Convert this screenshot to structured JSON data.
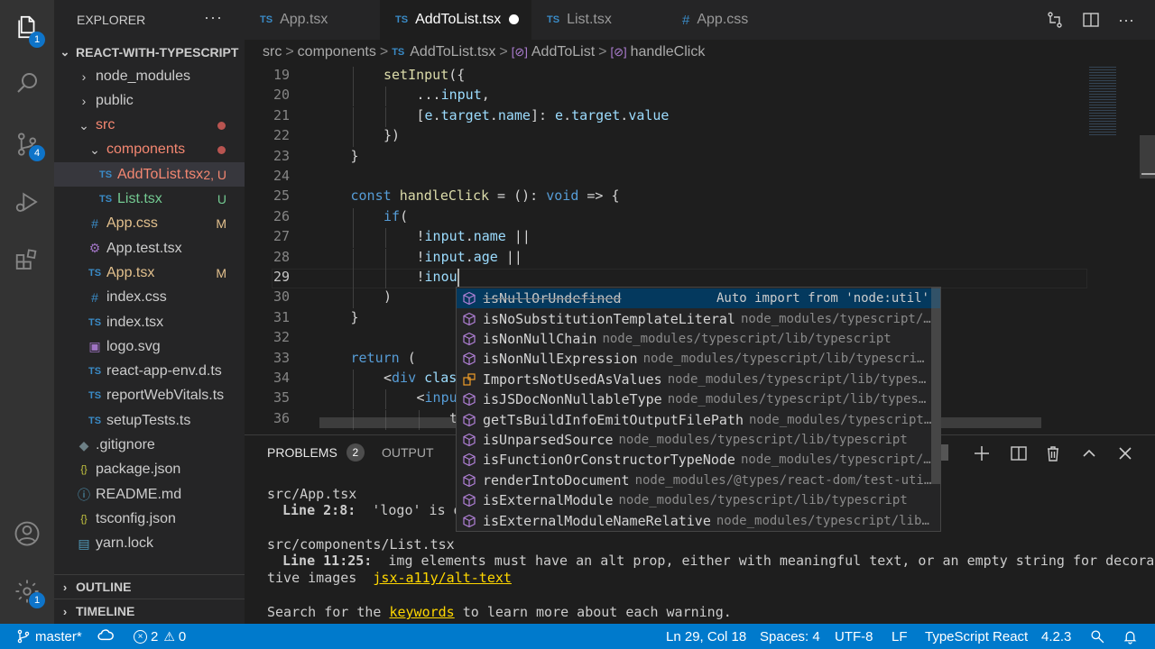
{
  "activity": {
    "explorer_badge": "1",
    "scm_badge": "4",
    "settings_badge": "1"
  },
  "sidebar": {
    "title": "EXPLORER",
    "dots": "···",
    "root": "REACT-WITH-TYPESCRIPT",
    "items": [
      {
        "label": "node_modules",
        "status": ""
      },
      {
        "label": "public",
        "status": ""
      },
      {
        "label": "src",
        "status": ""
      },
      {
        "label": "components",
        "status": ""
      },
      {
        "label": "AddToList.tsx",
        "status": "2, U"
      },
      {
        "label": "List.tsx",
        "status": "U"
      },
      {
        "label": "App.css",
        "status": "M"
      },
      {
        "label": "App.test.tsx",
        "status": ""
      },
      {
        "label": "App.tsx",
        "status": "M"
      },
      {
        "label": "index.css",
        "status": ""
      },
      {
        "label": "index.tsx",
        "status": ""
      },
      {
        "label": "logo.svg",
        "status": ""
      },
      {
        "label": "react-app-env.d.ts",
        "status": ""
      },
      {
        "label": "reportWebVitals.ts",
        "status": ""
      },
      {
        "label": "setupTests.ts",
        "status": ""
      },
      {
        "label": ".gitignore",
        "status": ""
      },
      {
        "label": "package.json",
        "status": ""
      },
      {
        "label": "README.md",
        "status": ""
      },
      {
        "label": "tsconfig.json",
        "status": ""
      },
      {
        "label": "yarn.lock",
        "status": ""
      }
    ],
    "outline": "OUTLINE",
    "timeline": "TIMELINE"
  },
  "tabs": [
    {
      "label": "App.tsx",
      "icon": "TS"
    },
    {
      "label": "AddToList.tsx",
      "icon": "TS"
    },
    {
      "label": "List.tsx",
      "icon": "TS"
    },
    {
      "label": "App.css",
      "icon": "#"
    }
  ],
  "breadcrumb": {
    "c1": "src",
    "c2": "components",
    "c3": "AddToList.tsx",
    "c4": "AddToList",
    "c5": "handleClick",
    "sep": ">",
    "ts": "TS",
    "sym": "[⊘]"
  },
  "editor": {
    "line_numbers": [
      "19",
      "20",
      "21",
      "22",
      "23",
      "24",
      "25",
      "26",
      "27",
      "28",
      "29",
      "30",
      "31",
      "32",
      "33",
      "34",
      "35",
      "36"
    ],
    "lines": [
      "setInput({",
      "...input,",
      "[e.target.name]: e.target.value",
      "})",
      "}",
      "",
      "const handleClick = (): void => {",
      "if(",
      "!input.name ||",
      "!input.age ||",
      "!inou",
      ")",
      "}",
      "",
      "return (",
      "<div clas",
      "<inpu",
      "t"
    ]
  },
  "suggest": [
    {
      "label": "isNullOrUndefined",
      "detail": "Auto import from 'node:util'",
      "icon": "cube-icon"
    },
    {
      "label": "isNoSubstitutionTemplateLiteral",
      "detail": "node_modules/typescript/…",
      "icon": "cube-icon"
    },
    {
      "label": "isNonNullChain",
      "detail": "node_modules/typescript/lib/typescript",
      "icon": "cube-icon"
    },
    {
      "label": "isNonNullExpression",
      "detail": "node_modules/typescript/lib/typescri…",
      "icon": "cube-icon"
    },
    {
      "label": "ImportsNotUsedAsValues",
      "detail": "node_modules/typescript/lib/types…",
      "icon": "enum-icon"
    },
    {
      "label": "isJSDocNonNullableType",
      "detail": "node_modules/typescript/lib/types…",
      "icon": "cube-icon"
    },
    {
      "label": "getTsBuildInfoEmitOutputFilePath",
      "detail": "node_modules/typescript…",
      "icon": "cube-icon"
    },
    {
      "label": "isUnparsedSource",
      "detail": "node_modules/typescript/lib/typescript",
      "icon": "cube-icon"
    },
    {
      "label": "isFunctionOrConstructorTypeNode",
      "detail": "node_modules/typescript/…",
      "icon": "cube-icon"
    },
    {
      "label": "renderIntoDocument",
      "detail": "node_modules/@types/react-dom/test-uti…",
      "icon": "cube-icon"
    },
    {
      "label": "isExternalModule",
      "detail": "node_modules/typescript/lib/typescript",
      "icon": "cube-icon"
    },
    {
      "label": "isExternalModuleNameRelative",
      "detail": "node_modules/typescript/lib…",
      "icon": "cube-icon"
    }
  ],
  "panel": {
    "problems": "PROBLEMS",
    "problems_count": "2",
    "output": "OUTPUT",
    "file1": "src/App.tsx",
    "l1_loc": "Line 2:8:",
    "l1_msg": "'logo' is d",
    "file2": "src/components/List.tsx",
    "l2_loc": "Line 11:25:",
    "l2_msg": "img elements must have an alt prop, either with meaningful text, or an empty string for decora",
    "l2_cont": "tive images",
    "l2_rule": "jsx-a11y/alt-text",
    "search_pre": "Search for the",
    "search_link": "keywords",
    "search_post": "to learn more about each warning."
  },
  "status": {
    "branch": "master*",
    "errors": "2",
    "warnings": "0",
    "position": "Ln 29, Col 18",
    "spaces": "Spaces: 4",
    "encoding": "UTF-8",
    "eol": "LF",
    "language": "TypeScript React",
    "version": "4.2.3"
  }
}
